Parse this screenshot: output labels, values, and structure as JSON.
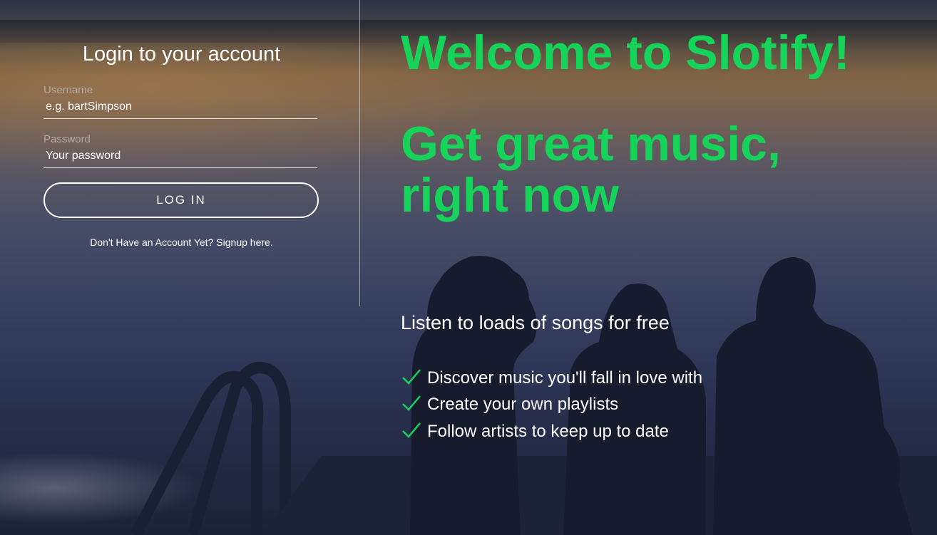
{
  "login": {
    "title": "Login to your account",
    "username_label": "Username",
    "username_placeholder": "e.g. bartSimpson",
    "password_label": "Password",
    "password_placeholder": "Your password",
    "login_button": "LOG IN",
    "signup_link": "Don't Have an Account Yet? Signup here."
  },
  "hero": {
    "headline": "Welcome to Slotify!",
    "subheadline": "Get great music, right now",
    "tagline": "Listen to loads of songs for free",
    "features": [
      {
        "icon": "check-icon",
        "text": "Discover music you'll fall in love with"
      },
      {
        "icon": "check-icon",
        "text": "Create your own playlists"
      },
      {
        "icon": "check-icon",
        "text": "Follow artists to keep up to date"
      }
    ]
  },
  "colors": {
    "accent": "#16d35a",
    "text": "#ffffff"
  }
}
